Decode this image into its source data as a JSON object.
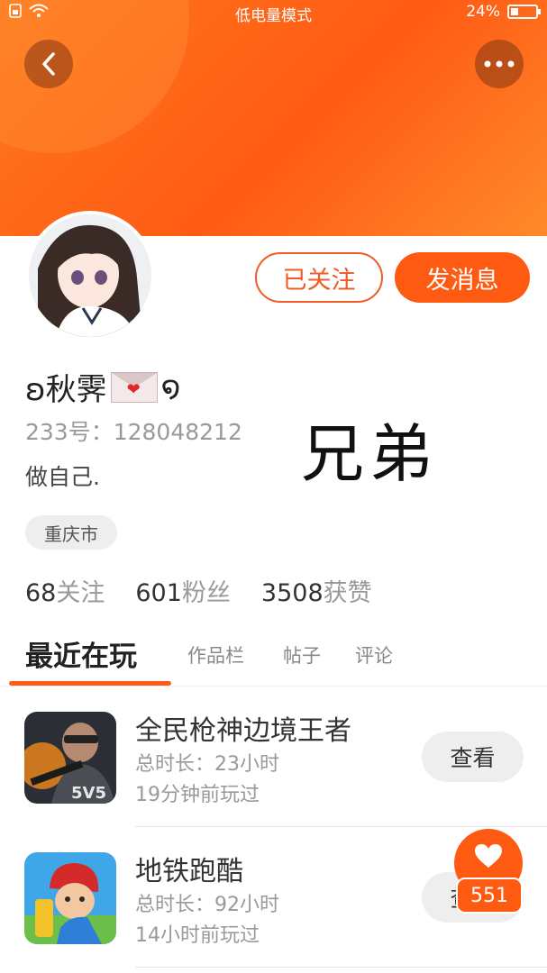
{
  "status_bar": {
    "mode": "低电量模式",
    "battery": "24%"
  },
  "profile": {
    "name_prefix": "ʚ秋霁",
    "name_suffix": "໑",
    "mail_heart": "❤",
    "uid": "233号：128048212",
    "bio": "做自己.",
    "overlay_text": "兄弟",
    "location": "重庆市",
    "follow_button": "已关注",
    "message_button": "发消息"
  },
  "stats": [
    {
      "num": "68",
      "label": "关注"
    },
    {
      "num": "601",
      "label": "粉丝"
    },
    {
      "num": "3508",
      "label": "获赞"
    }
  ],
  "tabs": [
    "最近在玩",
    "作品栏",
    "帖子",
    "评论"
  ],
  "games": [
    {
      "title": "全民枪神边境王者",
      "duration": "总时长：23小时",
      "ago": "19分钟前玩过",
      "action": "查看",
      "icon_text": "5V5"
    },
    {
      "title": "地铁跑酷",
      "duration": "总时长：92小时",
      "ago": "14小时前玩过",
      "action": "查看"
    }
  ],
  "like_count": "551",
  "colors": {
    "accent": "#ff5a12",
    "banner": "#ff6a18"
  }
}
